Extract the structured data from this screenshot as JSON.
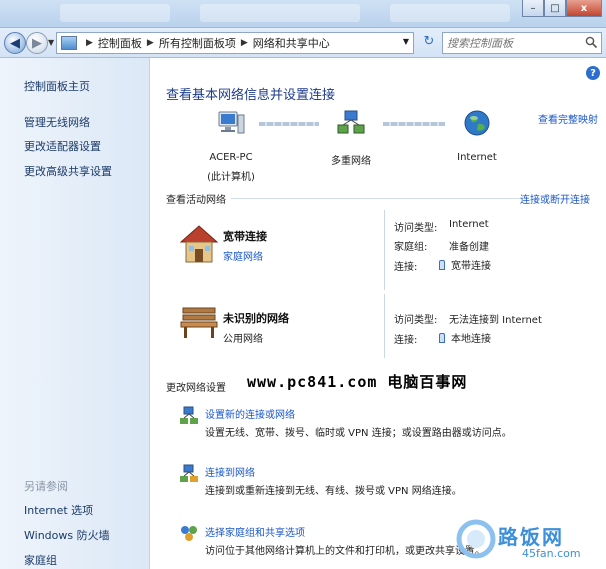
{
  "window": {
    "controls": {
      "minimize": "–",
      "maximize": "□",
      "close": "x"
    }
  },
  "address": {
    "crumbs": [
      "控制面板",
      "所有控制面板项",
      "网络和共享中心"
    ],
    "search_placeholder": "搜索控制面板"
  },
  "sidebar": {
    "items": [
      "控制面板主页",
      "管理无线网络",
      "更改适配器设置",
      "更改高级共享设置"
    ],
    "see_also_title": "另请参阅",
    "see_also": [
      "Internet 选项",
      "Windows 防火墙",
      "家庭组"
    ]
  },
  "main": {
    "title": "查看基本网络信息并设置连接",
    "view_full_map": "查看完整映射",
    "map": {
      "computer_name": "ACER-PC",
      "computer_sub": "(此计算机)",
      "middle": "多重网络",
      "internet": "Internet"
    },
    "active_networks_title": "查看活动网络",
    "connect_disconnect": "连接或断开连接",
    "networks": [
      {
        "name": "宽带连接",
        "type_link": "家庭网络",
        "access_label": "访问类型:",
        "access_value": "Internet",
        "homegroup_label": "家庭组:",
        "homegroup_value": "准备创建",
        "conn_label": "连接:",
        "conn_value": "宽带连接"
      },
      {
        "name": "未识别的网络",
        "type_text": "公用网络",
        "access_label": "访问类型:",
        "access_value": "无法连接到 Internet",
        "conn_label": "连接:",
        "conn_value": "本地连接"
      }
    ],
    "change_settings_title": "更改网络设置",
    "watermark": "www.pc841.com 电脑百事网",
    "tasks": [
      {
        "label": "设置新的连接或网络",
        "desc": "设置无线、宽带、拨号、临时或 VPN 连接；或设置路由器或访问点。"
      },
      {
        "label": "连接到网络",
        "desc": "连接到或重新连接到无线、有线、拨号或 VPN 网络连接。"
      },
      {
        "label": "选择家庭组和共享选项",
        "desc": "访问位于其他网络计算机上的文件和打印机，或更改共享设置。"
      }
    ]
  },
  "logo": {
    "title": "路饭网",
    "sub": "45fan.com"
  }
}
